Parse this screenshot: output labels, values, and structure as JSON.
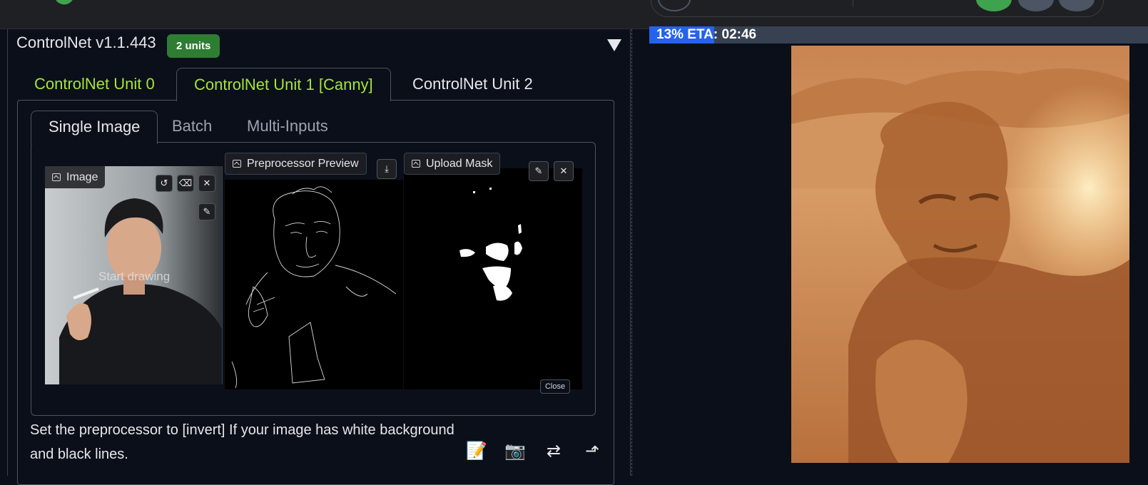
{
  "header": {
    "faded_text": "· · ·  ·    ·  ·    ·  ·"
  },
  "controlnet": {
    "title": "ControlNet v1.1.443",
    "units_badge": "2 units",
    "unit_tabs": [
      {
        "label": "ControlNet Unit 0",
        "active": false
      },
      {
        "label": "ControlNet Unit 1 [Canny]",
        "active": true
      },
      {
        "label": "ControlNet Unit 2",
        "active": false
      }
    ],
    "input_tabs": [
      {
        "label": "Single Image",
        "active": true
      },
      {
        "label": "Batch",
        "active": false
      },
      {
        "label": "Multi-Inputs",
        "active": false
      }
    ],
    "image_panel": {
      "label": "Image",
      "overlay_text": "Start drawing"
    },
    "preview_panel": {
      "label": "Preprocessor Preview"
    },
    "mask_panel": {
      "label": "Upload Mask",
      "close_label": "Close"
    },
    "hint": "Set the preprocessor to [invert] If your image has white background and black lines.",
    "tool_icons": [
      "memo-icon",
      "camera-icon",
      "swap-icon",
      "send-icon"
    ]
  },
  "progress": {
    "text": "13% ETA: 02:46",
    "percent": 13
  },
  "colors": {
    "accent_green": "#a3e635",
    "badge_green": "#2e7d32",
    "progress_blue": "#2563eb",
    "panel_border": "#4b5563"
  }
}
